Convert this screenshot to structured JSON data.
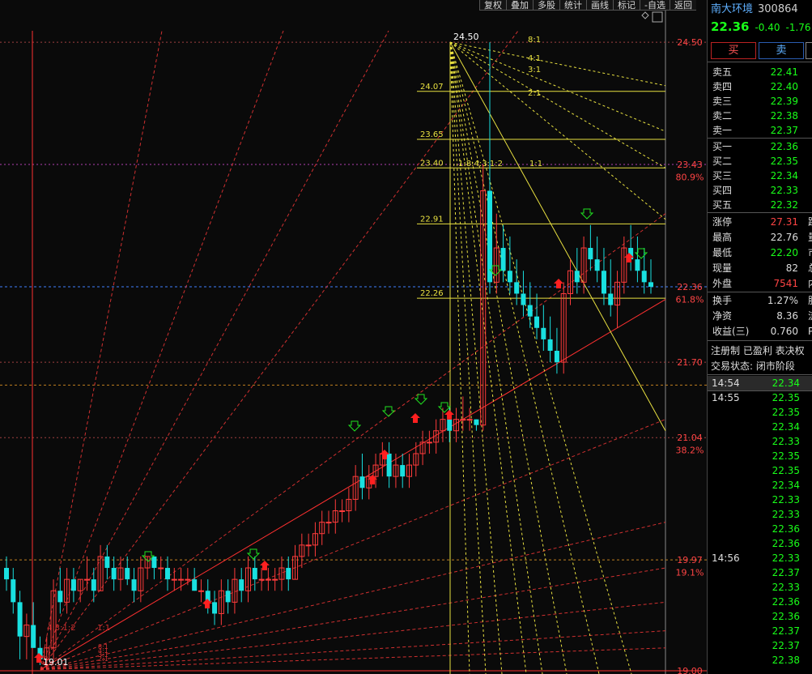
{
  "toolbar": [
    "复权",
    "叠加",
    "多股",
    "统计",
    "画线",
    "标记",
    "-自选",
    "返回"
  ],
  "price_labels": [
    {
      "text": "24.50",
      "price": 24.5,
      "color": "#ff4444"
    },
    {
      "text": "23.43",
      "price": 23.43,
      "color": "#ff4444"
    },
    {
      "text": "80.9%",
      "price": 23.32,
      "color": "#ff4444"
    },
    {
      "text": "22.36",
      "price": 22.36,
      "color": "#ff4444"
    },
    {
      "text": "61.8%",
      "price": 22.25,
      "color": "#ff4444"
    },
    {
      "text": "21.70",
      "price": 21.7,
      "color": "#ff4444"
    },
    {
      "text": "21.04",
      "price": 21.04,
      "color": "#ff4444"
    },
    {
      "text": "38.2%",
      "price": 20.93,
      "color": "#ff4444"
    },
    {
      "text": "19.97",
      "price": 19.97,
      "color": "#ff4444"
    },
    {
      "text": "19.1%",
      "price": 19.86,
      "color": "#ff4444"
    },
    {
      "text": "19.00",
      "price": 19.0,
      "color": "#ff4444"
    }
  ],
  "gann_levels": [
    "24.07",
    "23.65",
    "23.40",
    "22.91",
    "22.26"
  ],
  "gann_level_values": [
    24.07,
    23.65,
    23.4,
    22.91,
    22.26
  ],
  "gann_ratios_top": [
    "8:1",
    "4:1",
    "3:1",
    "2:1",
    "1:1",
    "1:8:4:3:1:2"
  ],
  "gann_ratios_bottom": [
    "1:1",
    "4:3:1:2"
  ],
  "high_label": "24.50",
  "low_label": "19.01",
  "panel": {
    "stock_name": "南大环境",
    "stock_code": "300864",
    "price": "22.36",
    "change": "-0.40",
    "change_pct": "-1.76",
    "buy_button": "买",
    "sell_button": "卖",
    "asks": [
      {
        "label": "卖五",
        "value": "22.41"
      },
      {
        "label": "卖四",
        "value": "22.40"
      },
      {
        "label": "卖三",
        "value": "22.39"
      },
      {
        "label": "卖二",
        "value": "22.38"
      },
      {
        "label": "卖一",
        "value": "22.37"
      }
    ],
    "bids": [
      {
        "label": "买一",
        "value": "22.36"
      },
      {
        "label": "买二",
        "value": "22.35"
      },
      {
        "label": "买三",
        "value": "22.34"
      },
      {
        "label": "买四",
        "value": "22.33"
      },
      {
        "label": "买五",
        "value": "22.32"
      }
    ],
    "stats_a": [
      {
        "label": "涨停",
        "value": "27.31",
        "color": "#ff4444",
        "extra": "跌"
      },
      {
        "label": "最高",
        "value": "22.76",
        "color": "#ddd",
        "extra": "量"
      },
      {
        "label": "最低",
        "value": "22.20",
        "color": "#19ff19",
        "extra": "市"
      },
      {
        "label": "现量",
        "value": "82",
        "color": "#ddd",
        "extra": "总"
      },
      {
        "label": "外盘",
        "value": "7541",
        "color": "#ff4444",
        "extra": "内"
      }
    ],
    "stats_b": [
      {
        "label": "换手",
        "value": "1.27%",
        "color": "#ddd",
        "extra": "股"
      },
      {
        "label": "净资",
        "value": "8.36",
        "color": "#ddd",
        "extra": "流"
      },
      {
        "label": "收益(三)",
        "value": "0.760",
        "color": "#ddd",
        "extra": "P"
      }
    ],
    "reg_note": "注册制 已盈利 表决权",
    "trade_state": "交易状态: 闭市阶段",
    "ticks": [
      {
        "time": "14:54",
        "value": "22.34",
        "highlight": true
      },
      {
        "time": "14:55",
        "value": "22.35"
      },
      {
        "time": "",
        "value": "22.35"
      },
      {
        "time": "",
        "value": "22.34"
      },
      {
        "time": "",
        "value": "22.33"
      },
      {
        "time": "",
        "value": "22.35"
      },
      {
        "time": "",
        "value": "22.35"
      },
      {
        "time": "",
        "value": "22.34"
      },
      {
        "time": "",
        "value": "22.33"
      },
      {
        "time": "",
        "value": "22.33"
      },
      {
        "time": "",
        "value": "22.36"
      },
      {
        "time": "",
        "value": "22.36"
      },
      {
        "time": "14:56",
        "value": "22.33"
      },
      {
        "time": "",
        "value": "22.37"
      },
      {
        "time": "",
        "value": "22.33"
      },
      {
        "time": "",
        "value": "22.36"
      },
      {
        "time": "",
        "value": "22.36"
      },
      {
        "time": "",
        "value": "22.37"
      },
      {
        "time": "",
        "value": "22.37"
      },
      {
        "time": "",
        "value": "22.38"
      }
    ]
  },
  "chart_data": {
    "type": "candlestick",
    "ylim": [
      19.0,
      24.6
    ],
    "candles": [
      [
        19.9,
        20.0,
        19.7,
        19.8
      ],
      [
        19.8,
        19.9,
        19.5,
        19.6
      ],
      [
        19.6,
        19.7,
        19.1,
        19.3
      ],
      [
        19.3,
        19.5,
        19.1,
        19.4
      ],
      [
        19.4,
        19.6,
        19.2,
        19.2
      ],
      [
        19.2,
        19.3,
        19.05,
        19.1
      ],
      [
        19.1,
        19.3,
        19.01,
        19.2
      ],
      [
        19.2,
        19.8,
        19.1,
        19.7
      ],
      [
        19.7,
        19.9,
        19.5,
        19.6
      ],
      [
        19.6,
        19.9,
        19.5,
        19.8
      ],
      [
        19.8,
        19.9,
        19.6,
        19.7
      ],
      [
        19.7,
        19.8,
        19.6,
        19.8
      ],
      [
        19.8,
        20.0,
        19.7,
        19.8
      ],
      [
        19.8,
        19.9,
        19.6,
        19.7
      ],
      [
        19.7,
        20.1,
        19.7,
        20.0
      ],
      [
        20.0,
        20.1,
        19.8,
        19.9
      ],
      [
        19.9,
        20.0,
        19.7,
        19.8
      ],
      [
        19.8,
        20.0,
        19.7,
        19.9
      ],
      [
        19.9,
        20.0,
        19.75,
        19.8
      ],
      [
        19.8,
        19.9,
        19.6,
        19.7
      ],
      [
        19.7,
        20.0,
        19.6,
        19.9
      ],
      [
        19.9,
        20.0,
        19.8,
        20.0
      ],
      [
        20.0,
        20.0,
        19.8,
        19.9
      ],
      [
        19.9,
        20.0,
        19.8,
        19.9
      ],
      [
        19.9,
        20.0,
        19.7,
        19.8
      ],
      [
        19.8,
        19.9,
        19.7,
        19.8
      ],
      [
        19.8,
        19.9,
        19.7,
        19.8
      ],
      [
        19.8,
        19.9,
        19.75,
        19.8
      ],
      [
        19.8,
        19.9,
        19.7,
        19.7
      ],
      [
        19.7,
        19.8,
        19.6,
        19.7
      ],
      [
        19.7,
        19.8,
        19.5,
        19.6
      ],
      [
        19.6,
        19.7,
        19.4,
        19.5
      ],
      [
        19.5,
        19.8,
        19.4,
        19.7
      ],
      [
        19.7,
        19.8,
        19.5,
        19.6
      ],
      [
        19.6,
        19.9,
        19.5,
        19.8
      ],
      [
        19.8,
        19.9,
        19.6,
        19.7
      ],
      [
        19.7,
        20.0,
        19.6,
        19.9
      ],
      [
        19.9,
        20.0,
        19.7,
        19.8
      ],
      [
        19.8,
        19.9,
        19.7,
        19.8
      ],
      [
        19.8,
        19.9,
        19.7,
        19.8
      ],
      [
        19.8,
        19.9,
        19.7,
        19.8
      ],
      [
        19.8,
        20.0,
        19.7,
        19.9
      ],
      [
        19.9,
        20.0,
        19.7,
        19.8
      ],
      [
        19.8,
        20.1,
        19.8,
        20.0
      ],
      [
        20.0,
        20.2,
        19.9,
        20.1
      ],
      [
        20.1,
        20.2,
        20.0,
        20.1
      ],
      [
        20.1,
        20.3,
        20.0,
        20.2
      ],
      [
        20.2,
        20.4,
        20.1,
        20.3
      ],
      [
        20.3,
        20.4,
        20.2,
        20.3
      ],
      [
        20.3,
        20.5,
        20.2,
        20.4
      ],
      [
        20.4,
        20.5,
        20.3,
        20.4
      ],
      [
        20.4,
        20.6,
        20.3,
        20.5
      ],
      [
        20.5,
        20.8,
        20.4,
        20.7
      ],
      [
        20.7,
        20.9,
        20.5,
        20.6
      ],
      [
        20.6,
        20.8,
        20.5,
        20.7
      ],
      [
        20.7,
        20.9,
        20.6,
        20.8
      ],
      [
        20.8,
        21.0,
        20.7,
        20.9
      ],
      [
        20.9,
        21.0,
        20.6,
        20.7
      ],
      [
        20.7,
        20.9,
        20.6,
        20.8
      ],
      [
        20.8,
        20.9,
        20.6,
        20.7
      ],
      [
        20.7,
        20.9,
        20.6,
        20.8
      ],
      [
        20.8,
        21.0,
        20.7,
        20.9
      ],
      [
        20.9,
        21.1,
        20.8,
        21.0
      ],
      [
        21.0,
        21.1,
        20.9,
        21.0
      ],
      [
        21.0,
        21.2,
        20.9,
        21.1
      ],
      [
        21.1,
        21.3,
        21.0,
        21.2
      ],
      [
        21.2,
        21.3,
        21.0,
        21.1
      ],
      [
        21.1,
        21.3,
        21.0,
        21.2
      ],
      [
        21.2,
        21.4,
        21.1,
        21.2
      ],
      [
        21.2,
        21.3,
        21.1,
        21.2
      ],
      [
        21.2,
        21.2,
        21.1,
        21.15
      ],
      [
        21.15,
        23.43,
        21.1,
        23.2
      ],
      [
        23.2,
        24.5,
        22.3,
        22.4
      ],
      [
        22.4,
        23.0,
        22.3,
        22.7
      ],
      [
        22.7,
        22.9,
        22.4,
        22.5
      ],
      [
        22.5,
        22.8,
        22.3,
        22.4
      ],
      [
        22.4,
        22.6,
        22.2,
        22.3
      ],
      [
        22.3,
        22.5,
        22.1,
        22.2
      ],
      [
        22.2,
        22.4,
        22.0,
        22.1
      ],
      [
        22.1,
        22.3,
        21.9,
        22.0
      ],
      [
        22.0,
        22.2,
        21.8,
        21.9
      ],
      [
        21.9,
        22.1,
        21.7,
        21.8
      ],
      [
        21.8,
        22.0,
        21.6,
        21.7
      ],
      [
        21.7,
        22.4,
        21.6,
        22.3
      ],
      [
        22.3,
        22.6,
        22.2,
        22.5
      ],
      [
        22.5,
        22.7,
        22.3,
        22.4
      ],
      [
        22.4,
        22.8,
        22.3,
        22.7
      ],
      [
        22.7,
        22.9,
        22.5,
        22.6
      ],
      [
        22.6,
        22.8,
        22.4,
        22.5
      ],
      [
        22.5,
        22.7,
        22.2,
        22.3
      ],
      [
        22.3,
        22.6,
        22.1,
        22.2
      ],
      [
        22.2,
        22.5,
        22.0,
        22.4
      ],
      [
        22.4,
        22.8,
        22.3,
        22.7
      ],
      [
        22.7,
        22.9,
        22.5,
        22.6
      ],
      [
        22.6,
        22.8,
        22.4,
        22.5
      ],
      [
        22.5,
        22.7,
        22.3,
        22.4
      ],
      [
        22.4,
        22.6,
        22.3,
        22.36
      ]
    ]
  }
}
